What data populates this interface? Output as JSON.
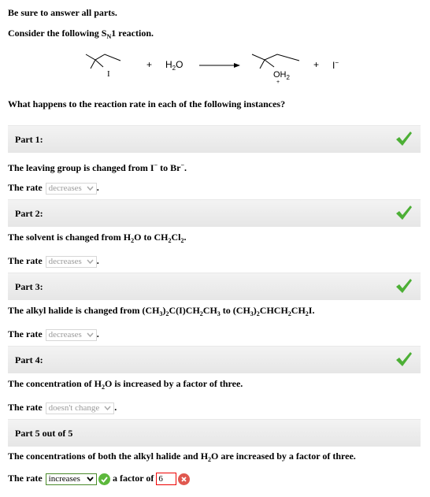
{
  "header": {
    "instruction": "Be sure to answer all parts.",
    "consider_prefix": "Consider the following S",
    "consider_sub": "N",
    "consider_suffix": "1 reaction."
  },
  "reaction": {
    "plus1": "+",
    "water": "H",
    "water_sub": "2",
    "water_o": "O",
    "plus2": "+",
    "iodide": "I",
    "iodide_charge": "−",
    "sub_label_I": "I",
    "prod_label": "OH",
    "prod_sub": "2",
    "prod_charge": "+"
  },
  "question": "What happens to the reaction rate in each of the following instances?",
  "parts": [
    {
      "label": "Part 1:",
      "statement": [
        "The leaving group is changed from I",
        "−",
        " to Br",
        "−",
        "."
      ],
      "rate_prefix": "The rate",
      "rate_value": "decreases",
      "suffix": ".",
      "status": "correct"
    },
    {
      "label": "Part 2:",
      "statement": [
        "The solvent is changed from H",
        "2",
        "O to CH",
        "2",
        "Cl",
        "2",
        "."
      ],
      "rate_prefix": "The rate",
      "rate_value": "decreases",
      "suffix": ".",
      "status": "correct"
    },
    {
      "label": "Part 3:",
      "statement": [
        "The alkyl halide is changed from (CH",
        "3",
        ")",
        "2",
        "C(I)CH",
        "2",
        "CH",
        "3",
        " to (CH",
        "3",
        ")",
        "2",
        "CHCH",
        "2",
        "CH",
        "2",
        "I."
      ],
      "rate_prefix": "The rate",
      "rate_value": "decreases",
      "suffix": ".",
      "status": "correct"
    },
    {
      "label": "Part 4:",
      "statement": [
        "The concentration of H",
        "2",
        "O is increased by a factor of three."
      ],
      "rate_prefix": "The rate",
      "rate_value": "doesn't change",
      "suffix": ".",
      "status": "correct"
    },
    {
      "label": "Part 5 out of 5",
      "statement": [
        "The concentrations of both the alkyl halide and H",
        "2",
        "O are increased by a factor of three."
      ],
      "rate_prefix": "The rate",
      "rate_value": "increases",
      "factor_label": "a factor of",
      "factor_value": "6",
      "status": "in-progress"
    }
  ],
  "colors": {
    "check_green": "#4caf35",
    "ok_green": "#5cb83c",
    "error_red": "#e0584f",
    "bar_gray": "#ececec"
  },
  "icons": {
    "part_status": "checkmark-icon",
    "dropdown": "chevron-down-icon",
    "correct": "check-circle-icon",
    "incorrect": "x-circle-icon"
  }
}
